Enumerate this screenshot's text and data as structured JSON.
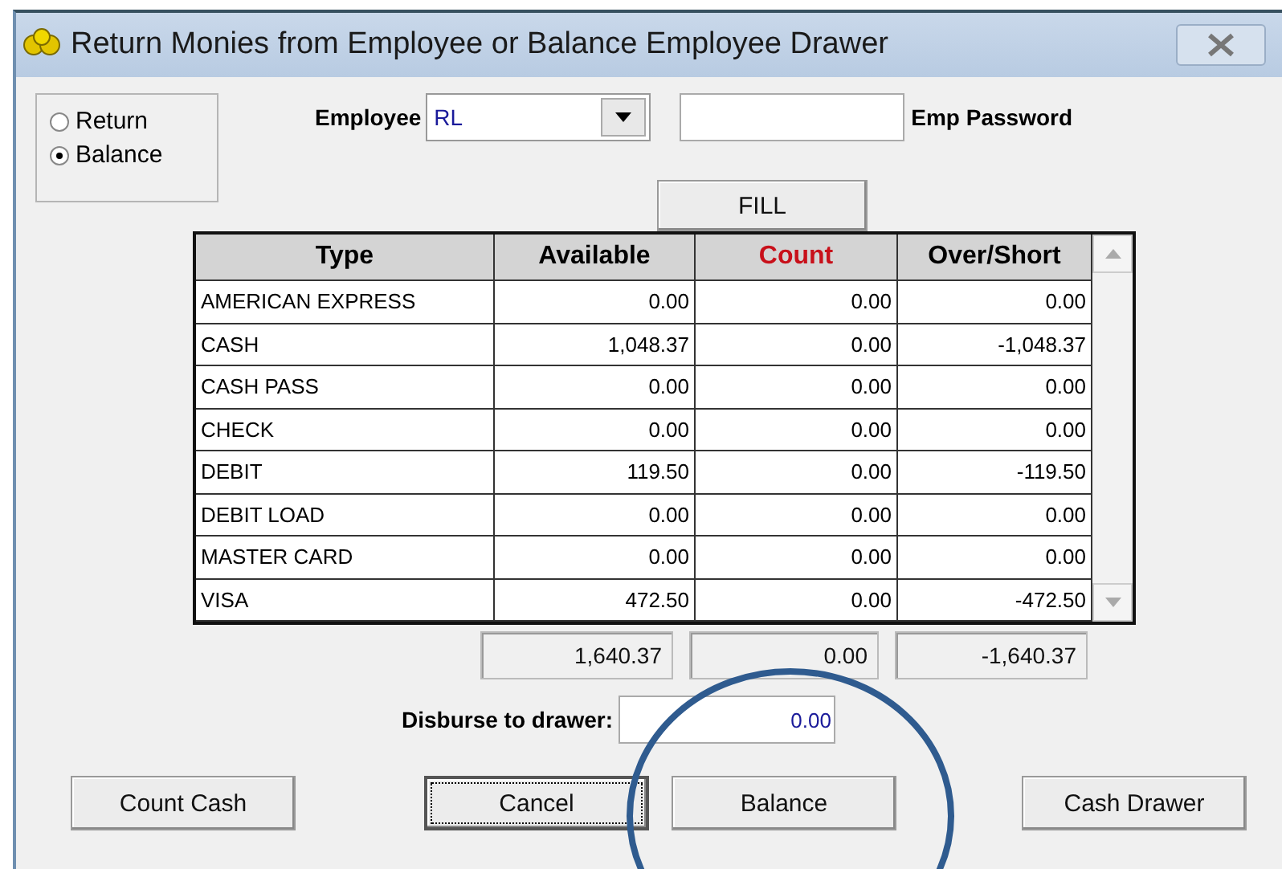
{
  "window": {
    "title": "Return Monies from Employee or Balance Employee Drawer"
  },
  "mode": [
    {
      "label": "Return",
      "selected": false
    },
    {
      "label": "Balance",
      "selected": true
    }
  ],
  "employee": {
    "label": "Employee",
    "value": "RL"
  },
  "password": {
    "label": "Emp Password"
  },
  "fill_button": "FILL",
  "table": {
    "columns": [
      "Type",
      "Available",
      "Count",
      "Over/Short"
    ],
    "rows": [
      [
        "AMERICAN EXPRESS",
        "0.00",
        "0.00",
        "0.00"
      ],
      [
        "CASH",
        "1,048.37",
        "0.00",
        "-1,048.37"
      ],
      [
        "CASH PASS",
        "0.00",
        "0.00",
        "0.00"
      ],
      [
        "CHECK",
        "0.00",
        "0.00",
        "0.00"
      ],
      [
        "DEBIT",
        "119.50",
        "0.00",
        "-119.50"
      ],
      [
        "DEBIT LOAD",
        "0.00",
        "0.00",
        "0.00"
      ],
      [
        "MASTER CARD",
        "0.00",
        "0.00",
        "0.00"
      ],
      [
        "VISA",
        "472.50",
        "0.00",
        "-472.50"
      ]
    ]
  },
  "totals": [
    "1,640.37",
    "0.00",
    "-1,640.37"
  ],
  "disburse": {
    "label": "Disburse to drawer:",
    "value": "0.00"
  },
  "buttons": [
    {
      "label": "Count Cash",
      "focused": false
    },
    {
      "label": "Cancel",
      "focused": true
    },
    {
      "label": "Balance",
      "focused": false
    },
    {
      "label": "Cash Drawer",
      "focused": false
    }
  ]
}
